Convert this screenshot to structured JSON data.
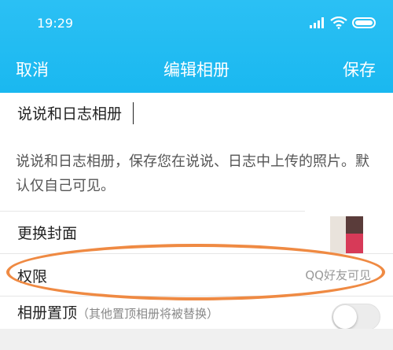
{
  "status_bar": {
    "time": "19:29",
    "icons": [
      "signal-icon",
      "wifi-icon",
      "battery-icon"
    ]
  },
  "nav": {
    "cancel_label": "取消",
    "title": "编辑相册",
    "save_label": "保存"
  },
  "album": {
    "name_value": "说说和日志相册",
    "description": "说说和日志相册，保存您在说说、日志中上传的照片。默认仅自己可见。"
  },
  "settings": {
    "cover_label": "更换封面",
    "permission_label": "权限",
    "permission_value": "QQ好友可见",
    "pin_label": "相册置顶",
    "pin_hint": "（其他置顶相册将被替换）",
    "pin_enabled": false
  },
  "colors": {
    "header": "#1ab8f0",
    "highlight_ring": "#ef8a43"
  }
}
